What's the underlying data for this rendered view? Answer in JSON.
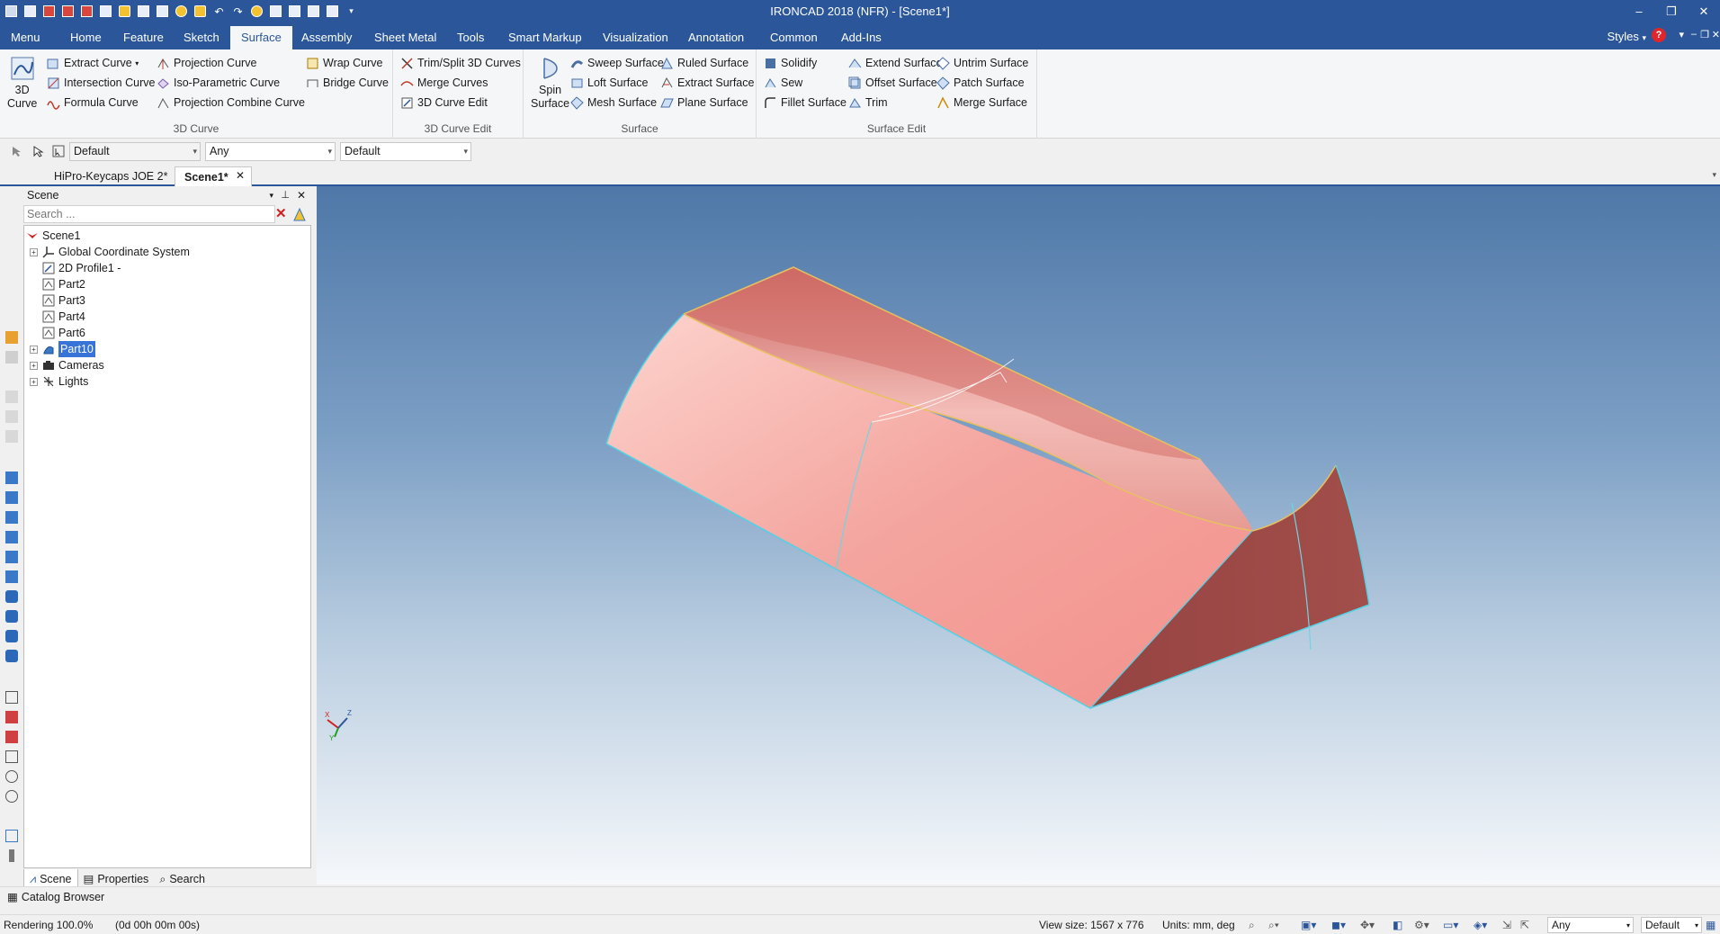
{
  "window": {
    "title": "IRONCAD 2018 (NFR) - [Scene1*]",
    "controls": [
      "–",
      "❐",
      "✕"
    ]
  },
  "ribbon_tabs": [
    "Menu",
    "Home",
    "Feature",
    "Sketch",
    "Surface",
    "Assembly",
    "Sheet Metal",
    "Tools",
    "Smart Markup",
    "Visualization",
    "Annotation",
    "Common",
    "Add-Ins"
  ],
  "active_tab": "Surface",
  "styles_label": "Styles",
  "help_icon": "?",
  "groups": {
    "curve3d": {
      "label": "3D Curve",
      "big": "3D\nCurve",
      "big_lines": [
        "3D",
        "Curve"
      ],
      "items": [
        "Extract Curve",
        "Intersection Curve",
        "Formula Curve",
        "Projection Curve",
        "Iso-Parametric Curve",
        "Projection Combine Curve",
        "Wrap Curve",
        "Bridge Curve"
      ]
    },
    "curve3d_edit": {
      "label": "3D Curve Edit",
      "items": [
        "Trim/Split 3D Curves",
        "Merge Curves",
        "3D Curve Edit"
      ]
    },
    "surface": {
      "label": "Surface",
      "big_lines": [
        "Spin",
        "Surface"
      ],
      "items": [
        "Sweep Surface",
        "Loft Surface",
        "Mesh Surface",
        "Ruled Surface",
        "Extract Surface",
        "Plane Surface"
      ]
    },
    "surface_edit": {
      "label": "Surface Edit",
      "items": [
        "Solidify",
        "Sew",
        "Fillet Surface",
        "Extend Surface",
        "Offset Surface",
        "Trim",
        "Untrim Surface",
        "Patch Surface",
        "Merge Surface"
      ]
    }
  },
  "subtoolbar": {
    "combo1": "Default",
    "combo2": "Any",
    "combo3": "Default"
  },
  "doc_tabs": [
    "HiPro-Keycaps JOE 2*",
    "Scene1*"
  ],
  "scene_panel": {
    "title": "Scene",
    "search_placeholder": "Search ...",
    "tree": [
      {
        "label": "Scene1",
        "icon": "scene-icon"
      },
      {
        "label": "Global Coordinate System",
        "icon": "axes-icon"
      },
      {
        "label": "2D Profile1 -",
        "icon": "profile-icon"
      },
      {
        "label": "Part2",
        "icon": "part-icon"
      },
      {
        "label": "Part3",
        "icon": "part-icon"
      },
      {
        "label": "Part4",
        "icon": "part-icon"
      },
      {
        "label": "Part6",
        "icon": "part-icon"
      },
      {
        "label": "Part10",
        "icon": "surface-part-icon"
      },
      {
        "label": "Cameras",
        "icon": "camera-icon"
      },
      {
        "label": "Lights",
        "icon": "light-icon"
      }
    ],
    "selected": "Part10",
    "bottom_tabs": [
      "Scene",
      "Properties",
      "Search"
    ]
  },
  "triad": {
    "x": "X",
    "y": "Y",
    "z": "Z"
  },
  "catalog_browser": "Catalog Browser",
  "status": {
    "rendering": "Rendering 100.0%",
    "time": "(0d 00h 00m 00s)",
    "view_size": "View size: 1567 x 776",
    "units": "Units: mm, deg",
    "filter": "Any",
    "style": "Default"
  },
  "colors": {
    "titlebar": "#2b579a",
    "selection": "#3874d8",
    "model_face": "#f0938f",
    "model_dark": "#9b4a48",
    "model_edge": "#4fd0e0"
  }
}
